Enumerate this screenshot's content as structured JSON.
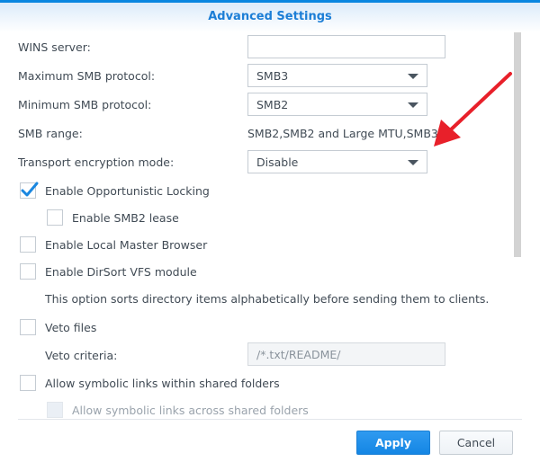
{
  "dialog": {
    "title": "Advanced Settings"
  },
  "form": {
    "wins_server": {
      "label": "WINS server:",
      "value": ""
    },
    "max_smb": {
      "label": "Maximum SMB protocol:",
      "value": "SMB3"
    },
    "min_smb": {
      "label": "Minimum SMB protocol:",
      "value": "SMB2"
    },
    "smb_range": {
      "label": "SMB range:",
      "value": "SMB2,SMB2 and Large MTU,SMB3"
    },
    "transport_encryption": {
      "label": "Transport encryption mode:",
      "value": "Disable"
    },
    "checkboxes": {
      "oplocks": {
        "label": "Enable Opportunistic Locking",
        "checked": true
      },
      "smb2_lease": {
        "label": "Enable SMB2 lease",
        "checked": false
      },
      "local_master": {
        "label": "Enable Local Master Browser",
        "checked": false
      },
      "dirsort": {
        "label": "Enable DirSort VFS module",
        "checked": false
      },
      "veto_files": {
        "label": "Veto files",
        "checked": false
      },
      "symlinks_within": {
        "label": "Allow symbolic links within shared folders",
        "checked": false
      },
      "symlinks_across": {
        "label": "Allow symbolic links across shared folders",
        "checked": false,
        "disabled": true
      }
    },
    "dirsort_description": "This option sorts directory items alphabetically before sending them to clients.",
    "veto_criteria": {
      "label": "Veto criteria:",
      "placeholder": "/*.txt/README/"
    }
  },
  "footer": {
    "apply_label": "Apply",
    "cancel_label": "Cancel"
  },
  "colors": {
    "accent": "#1c7ed6",
    "annotation_arrow": "#e8202a"
  }
}
